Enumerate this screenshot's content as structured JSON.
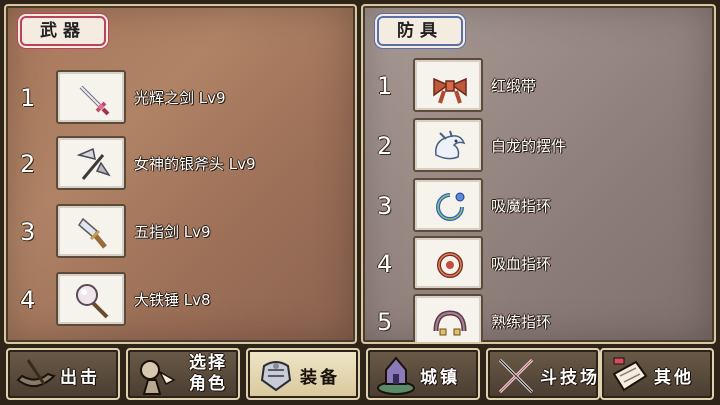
{
  "weapons": {
    "title": "武器",
    "items": [
      {
        "num": "1",
        "name": "光辉之剑 Lv9",
        "icon": "glory-sword-icon"
      },
      {
        "num": "2",
        "name": "女神的银斧头 Lv9",
        "icon": "silver-axe-icon"
      },
      {
        "num": "3",
        "name": "五指剑 Lv9",
        "icon": "five-finger-sword-icon"
      },
      {
        "num": "4",
        "name": "大铁锤 Lv8",
        "icon": "iron-hammer-icon"
      }
    ]
  },
  "armor": {
    "title": "防具",
    "items": [
      {
        "num": "1",
        "name": "红缎带",
        "icon": "red-ribbon-icon"
      },
      {
        "num": "2",
        "name": "白龙的摆件",
        "icon": "white-dragon-ornament-icon"
      },
      {
        "num": "3",
        "name": "吸魔指环",
        "icon": "magic-absorb-ring-icon"
      },
      {
        "num": "4",
        "name": "吸血指环",
        "icon": "vampire-ring-icon"
      },
      {
        "num": "5",
        "name": "熟练指环",
        "icon": "skill-ring-icon"
      }
    ]
  },
  "nav": {
    "tabs": [
      {
        "label": "出击",
        "icon": "sortie-icon"
      },
      {
        "label": "选择角色",
        "line1": "选择",
        "line2": "角色",
        "icon": "character-select-icon"
      },
      {
        "label": "装备",
        "icon": "equipment-icon",
        "active": true
      },
      {
        "label": "城镇",
        "icon": "town-icon"
      },
      {
        "label": "斗技场",
        "icon": "arena-icon"
      },
      {
        "label": "其他",
        "icon": "other-icon"
      }
    ]
  },
  "colors": {
    "weapons_accent": "#b8435a",
    "armor_accent": "#5a6fa8"
  }
}
